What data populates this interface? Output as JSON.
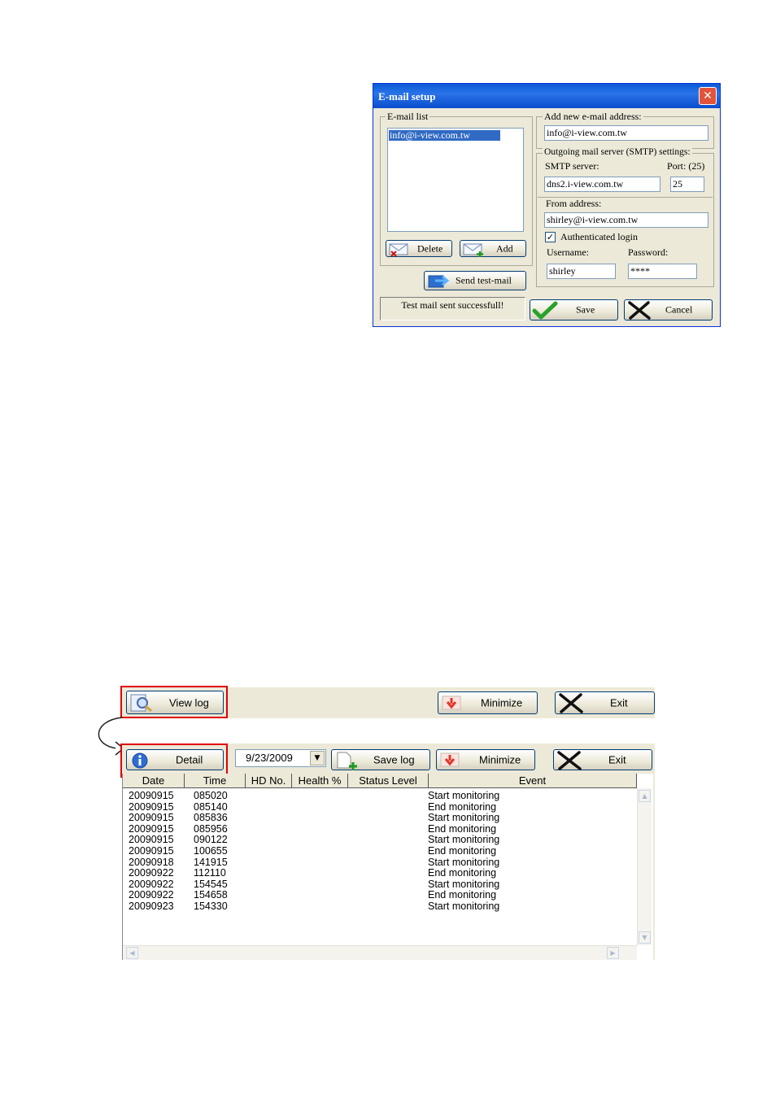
{
  "email_setup": {
    "title": "E-mail setup",
    "close_glyph": "✕",
    "email_list_label": "E-mail list",
    "email_list_items": [
      "info@i-view.com.tw"
    ],
    "delete_label": "Delete",
    "add_label": "Add",
    "send_test_label": "Send test-mail",
    "status_text": "Test mail sent successfull!",
    "add_new_label": "Add new e-mail address:",
    "add_new_value": "info@i-view.com.tw",
    "smtp_group_label": "Outgoing mail server (SMTP) settings:",
    "smtp_server_label": "SMTP server:",
    "port_label": "Port: (25)",
    "smtp_server_value": "dns2.i-view.com.tw",
    "port_value": "25",
    "from_label": "From address:",
    "from_value": "shirley@i-view.com.tw",
    "auth_check": "✓",
    "auth_label": "Authenticated login",
    "username_label": "Username:",
    "password_label": "Password:",
    "username_value": "shirley",
    "password_value": "****",
    "save_label": "Save",
    "cancel_label": "Cancel"
  },
  "toolbar_small": {
    "view_log_label": "View log",
    "minimize_label": "Minimize",
    "exit_label": "Exit"
  },
  "toolbar_log": {
    "detail_label": "Detail",
    "date_value": "9/23/2009",
    "dropdown_glyph": "▼",
    "save_log_label": "Save log",
    "minimize_label": "Minimize",
    "exit_label": "Exit"
  },
  "log_table": {
    "columns": [
      "Date",
      "Time",
      "HD No.",
      "Health %",
      "Status Level",
      "Event"
    ],
    "rows": [
      [
        "20090915",
        "085020",
        "Start monitoring"
      ],
      [
        "20090915",
        "085140",
        "End monitoring"
      ],
      [
        "20090915",
        "085836",
        "Start monitoring"
      ],
      [
        "20090915",
        "085956",
        "End monitoring"
      ],
      [
        "20090915",
        "090122",
        "Start monitoring"
      ],
      [
        "20090915",
        "100655",
        "End monitoring"
      ],
      [
        "20090918",
        "141915",
        "Start monitoring"
      ],
      [
        "20090922",
        "112110",
        "End monitoring"
      ],
      [
        "20090922",
        "154545",
        "Start monitoring"
      ],
      [
        "20090922",
        "154658",
        "End monitoring"
      ],
      [
        "20090923",
        "154330",
        "Start monitoring"
      ]
    ],
    "scroll_up": "▲",
    "scroll_down": "▼",
    "scroll_left": "◀",
    "scroll_right": "▶"
  },
  "colors": {
    "titlebar": "#0a5bd6",
    "highlight_box": "#e00000",
    "selection": "#316ac5",
    "panel_bg": "#ece9d8"
  }
}
